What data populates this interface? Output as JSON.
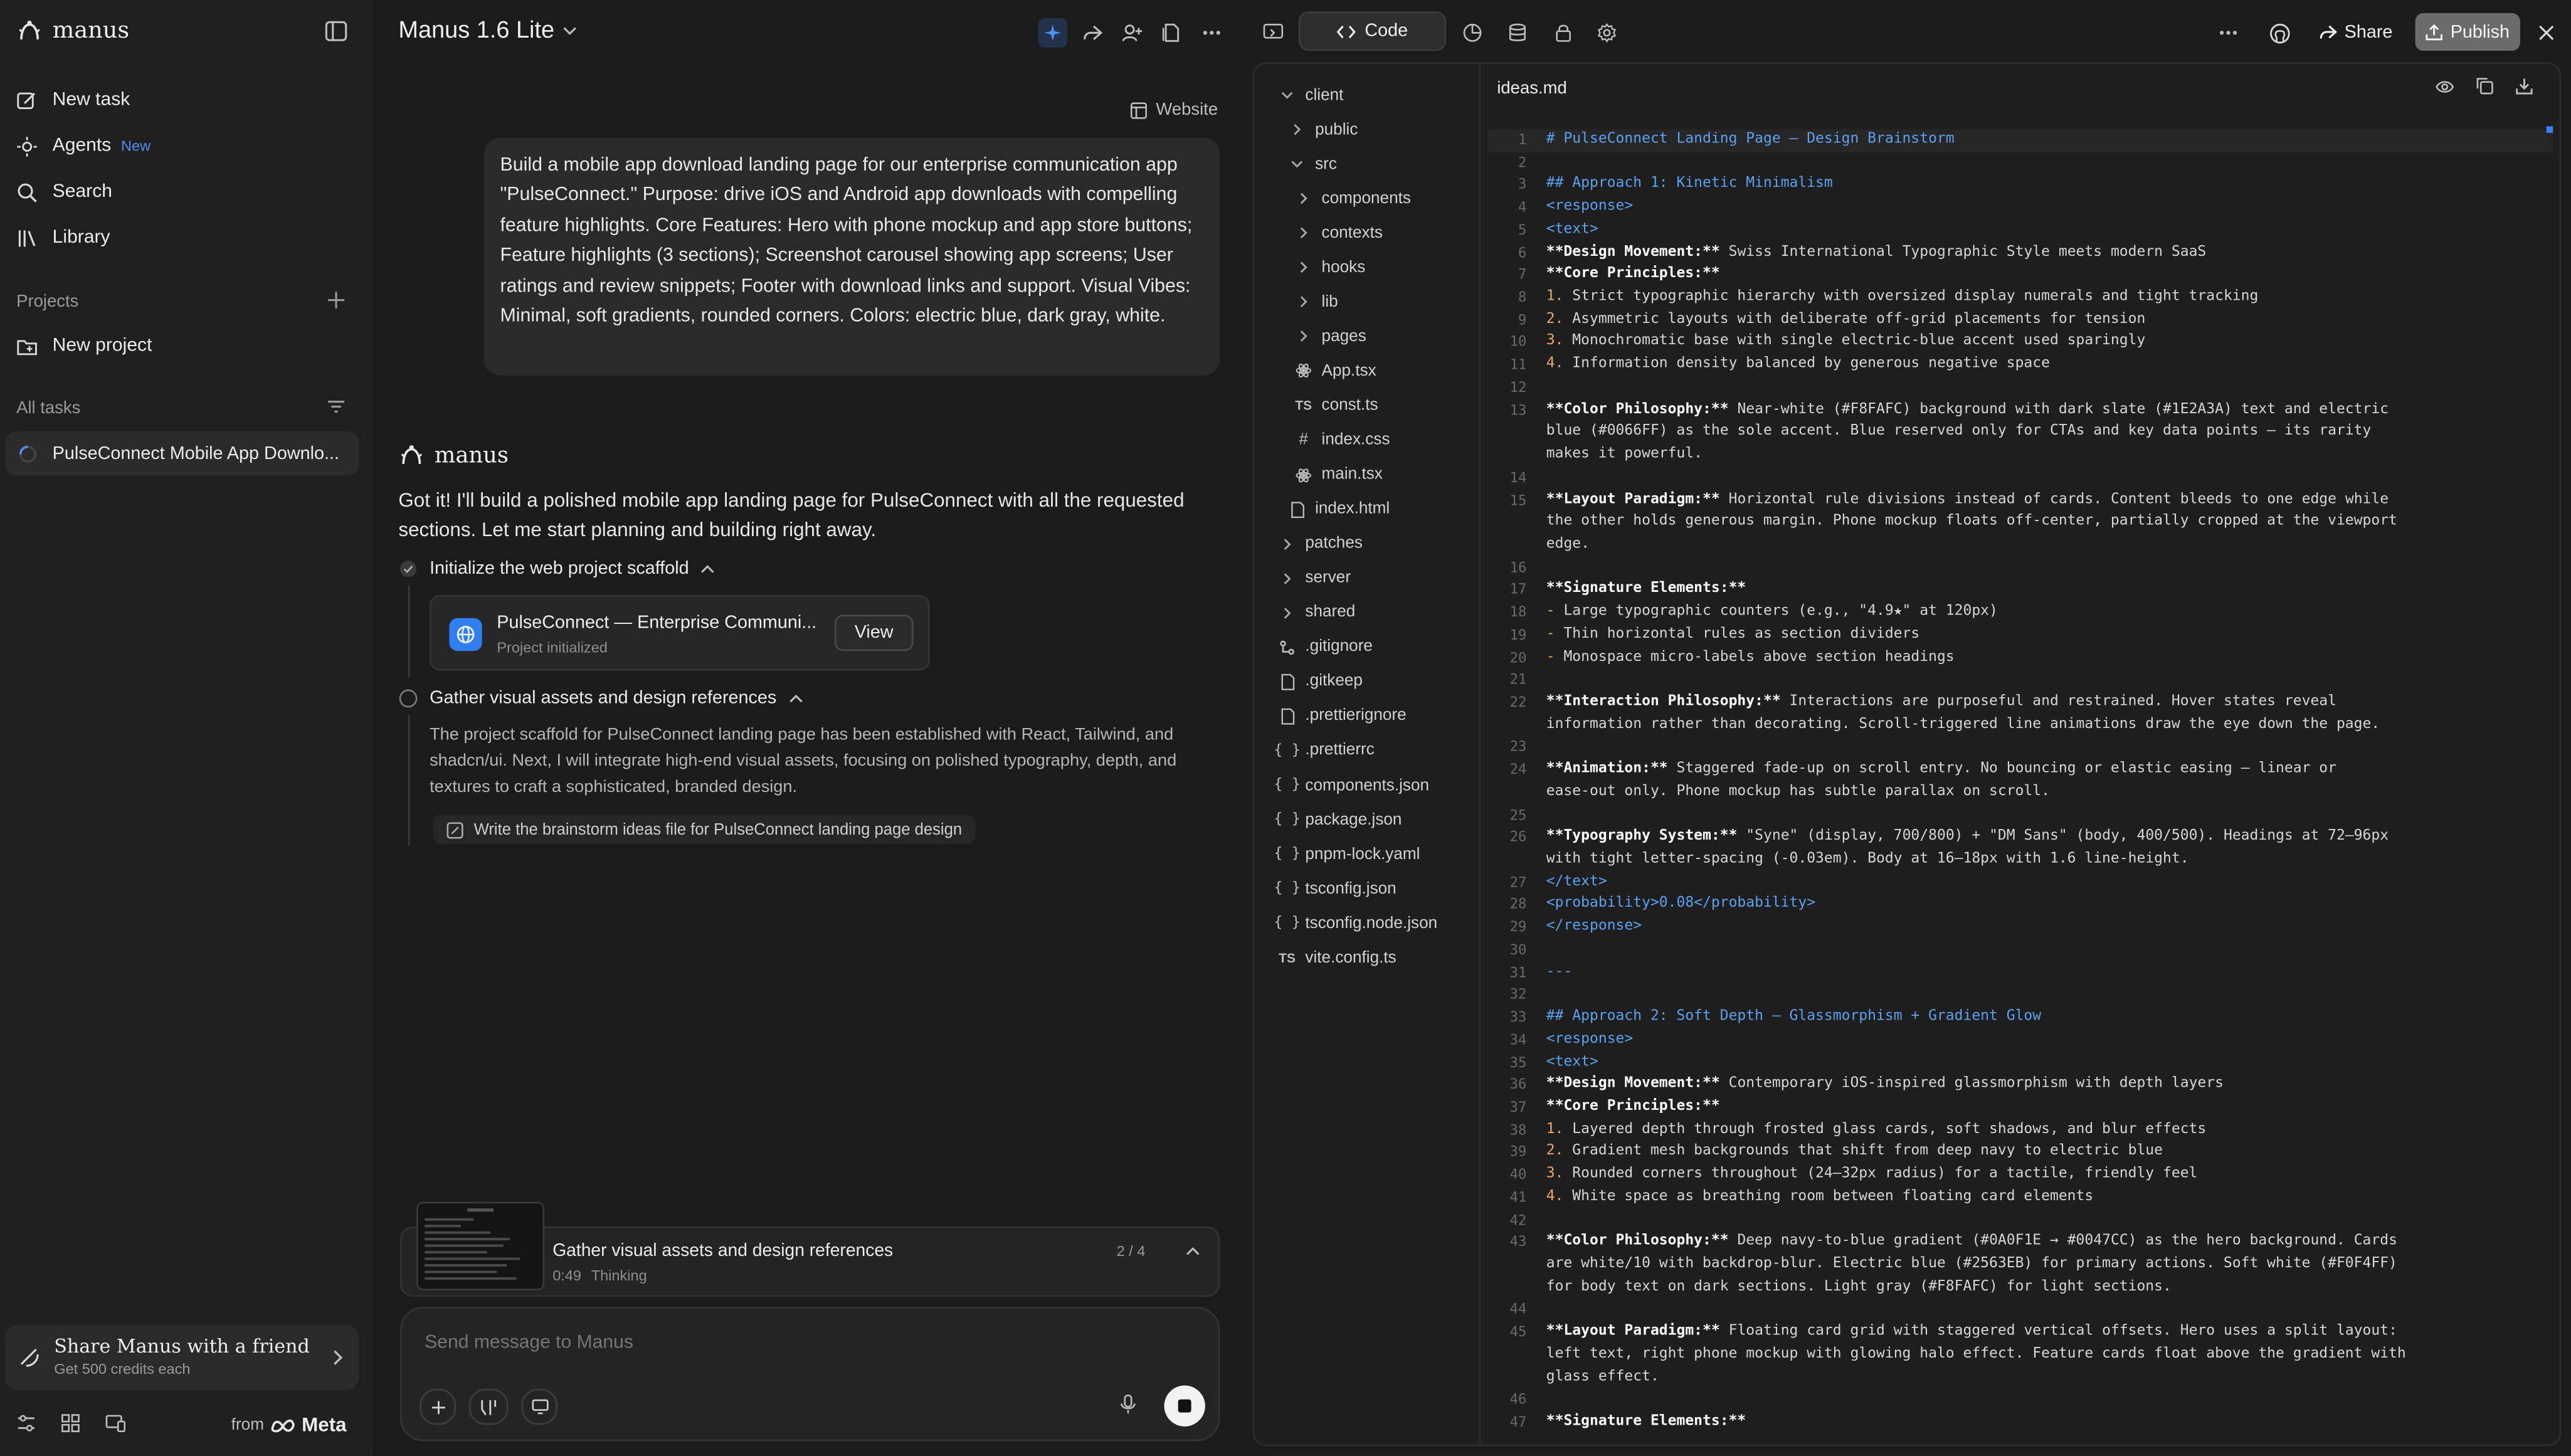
{
  "sidebar": {
    "brand": "manus",
    "nav": [
      {
        "label": "New task",
        "icon": "edit-icon"
      },
      {
        "label": "Agents",
        "icon": "agents-icon",
        "badge": "New"
      },
      {
        "label": "Search",
        "icon": "search-icon"
      },
      {
        "label": "Library",
        "icon": "library-icon"
      }
    ],
    "projects_label": "Projects",
    "new_project": "New project",
    "all_tasks_label": "All tasks",
    "task_item": "PulseConnect Mobile App Downlo...",
    "share_title": "Share Manus with a friend",
    "share_sub": "Get 500 credits each",
    "from_label": "from",
    "meta_label": "Meta"
  },
  "chat": {
    "model": "Manus 1.6 Lite",
    "website_label": "Website",
    "user_message": "Build a mobile app download landing page for our enterprise communication app \"PulseConnect.\" Purpose: drive iOS and Android app downloads with compelling feature highlights. Core Features: Hero with phone mockup and app store buttons; Feature highlights (3 sections); Screenshot carousel showing app screens; User ratings and review snippets; Footer with download links and support. Visual Vibes: Minimal, soft gradients, rounded corners. Colors: electric blue, dark gray, white.",
    "agent_name": "manus",
    "agent_reply": "Got it! I'll build a polished mobile app landing page for PulseConnect with all the requested sections. Let me start planning and building right away.",
    "step1": "Initialize the web project scaffold",
    "card_title": "PulseConnect — Enterprise Communi...",
    "card_sub": "Project initialized",
    "card_button": "View",
    "step2": "Gather visual assets and design references",
    "step2_desc": "The project scaffold for PulseConnect landing page has been established with React, Tailwind, and shadcn/ui. Next, I will integrate high-end visual assets, focusing on polished typography, depth, and textures to craft a sophisticated, branded design.",
    "subtask": "Write the brainstorm ideas file for PulseConnect landing page design",
    "status_title": "Gather visual assets and design references",
    "status_time": "0:49",
    "status_state": "Thinking",
    "status_count": "2 / 4",
    "input_placeholder": "Send message to Manus"
  },
  "topbar": {
    "code_tab": "Code",
    "share": "Share",
    "publish": "Publish"
  },
  "tree": [
    {
      "label": "client",
      "type": "folder-open",
      "depth": 0
    },
    {
      "label": "public",
      "type": "folder",
      "depth": 1
    },
    {
      "label": "src",
      "type": "folder-open",
      "depth": 1
    },
    {
      "label": "components",
      "type": "folder",
      "depth": 2
    },
    {
      "label": "contexts",
      "type": "folder",
      "depth": 2
    },
    {
      "label": "hooks",
      "type": "folder",
      "depth": 2
    },
    {
      "label": "lib",
      "type": "folder",
      "depth": 2
    },
    {
      "label": "pages",
      "type": "folder",
      "depth": 2
    },
    {
      "label": "App.tsx",
      "type": "react",
      "depth": 2
    },
    {
      "label": "const.ts",
      "type": "ts",
      "depth": 2
    },
    {
      "label": "index.css",
      "type": "css",
      "depth": 2
    },
    {
      "label": "main.tsx",
      "type": "react",
      "depth": 2
    },
    {
      "label": "index.html",
      "type": "file",
      "depth": 1
    },
    {
      "label": "patches",
      "type": "folder",
      "depth": 0
    },
    {
      "label": "server",
      "type": "folder",
      "depth": 0
    },
    {
      "label": "shared",
      "type": "folder",
      "depth": 0
    },
    {
      "label": ".gitignore",
      "type": "git",
      "depth": 0
    },
    {
      "label": ".gitkeep",
      "type": "file",
      "depth": 0
    },
    {
      "label": ".prettierignore",
      "type": "file",
      "depth": 0
    },
    {
      "label": ".prettierrc",
      "type": "json",
      "depth": 0
    },
    {
      "label": "components.json",
      "type": "json",
      "depth": 0
    },
    {
      "label": "package.json",
      "type": "json",
      "depth": 0
    },
    {
      "label": "pnpm-lock.yaml",
      "type": "json",
      "depth": 0
    },
    {
      "label": "tsconfig.json",
      "type": "json",
      "depth": 0
    },
    {
      "label": "tsconfig.node.json",
      "type": "json",
      "depth": 0
    },
    {
      "label": "vite.config.ts",
      "type": "ts",
      "depth": 0
    }
  ],
  "editor": {
    "filename": "ideas.md",
    "lines": [
      {
        "n": "1",
        "text": "# PulseConnect Landing Page — Design Brainstorm",
        "style": "h"
      },
      {
        "n": "2",
        "text": "",
        "style": ""
      },
      {
        "n": "3",
        "text": "## Approach 1: Kinetic Minimalism",
        "style": "h"
      },
      {
        "n": "4",
        "text": "<response>",
        "style": "tag"
      },
      {
        "n": "5",
        "text": "<text>",
        "style": "tag"
      },
      {
        "n": "6",
        "text": "**Design Movement:** Swiss International Typographic Style meets modern SaaS",
        "style": "b"
      },
      {
        "n": "7",
        "text": "**Core Principles:**",
        "style": "b"
      },
      {
        "n": "8",
        "text": "1. Strict typographic hierarchy with oversized display numerals and tight tracking",
        "style": "ol"
      },
      {
        "n": "9",
        "text": "2. Asymmetric layouts with deliberate off-grid placements for tension",
        "style": "ol"
      },
      {
        "n": "10",
        "text": "3. Monochromatic base with single electric-blue accent used sparingly",
        "style": "ol"
      },
      {
        "n": "11",
        "text": "4. Information density balanced by generous negative space",
        "style": "ol"
      },
      {
        "n": "12",
        "text": "",
        "style": ""
      },
      {
        "n": "13",
        "text": "**Color Philosophy:** Near-white (#F8FAFC) background with dark slate (#1E2A3A) text and electric",
        "style": "b"
      },
      {
        "n": "",
        "text": "blue (#0066FF) as the sole accent. Blue reserved only for CTAs and key data points — its rarity",
        "style": ""
      },
      {
        "n": "",
        "text": "makes it powerful.",
        "style": ""
      },
      {
        "n": "14",
        "text": "",
        "style": ""
      },
      {
        "n": "15",
        "text": "**Layout Paradigm:** Horizontal rule divisions instead of cards. Content bleeds to one edge while",
        "style": "b"
      },
      {
        "n": "",
        "text": "the other holds generous margin. Phone mockup floats off-center, partially cropped at the viewport",
        "style": ""
      },
      {
        "n": "",
        "text": "edge.",
        "style": ""
      },
      {
        "n": "16",
        "text": "",
        "style": ""
      },
      {
        "n": "17",
        "text": "**Signature Elements:**",
        "style": "b"
      },
      {
        "n": "18",
        "text": "- Large typographic counters (e.g., \"4.9★\" at 120px)",
        "style": "ol"
      },
      {
        "n": "19",
        "text": "- Thin horizontal rules as section dividers",
        "style": "ol"
      },
      {
        "n": "20",
        "text": "- Monospace micro-labels above section headings",
        "style": "ol"
      },
      {
        "n": "21",
        "text": "",
        "style": ""
      },
      {
        "n": "22",
        "text": "**Interaction Philosophy:** Interactions are purposeful and restrained. Hover states reveal",
        "style": "b"
      },
      {
        "n": "",
        "text": "information rather than decorating. Scroll-triggered line animations draw the eye down the page.",
        "style": ""
      },
      {
        "n": "23",
        "text": "",
        "style": ""
      },
      {
        "n": "24",
        "text": "**Animation:** Staggered fade-up on scroll entry. No bouncing or elastic easing — linear or",
        "style": "b"
      },
      {
        "n": "",
        "text": "ease-out only. Phone mockup has subtle parallax on scroll.",
        "style": ""
      },
      {
        "n": "25",
        "text": "",
        "style": ""
      },
      {
        "n": "26",
        "text": "**Typography System:** \"Syne\" (display, 700/800) + \"DM Sans\" (body, 400/500). Headings at 72–96px",
        "style": "b"
      },
      {
        "n": "",
        "text": "with tight letter-spacing (-0.03em). Body at 16–18px with 1.6 line-height.",
        "style": ""
      },
      {
        "n": "27",
        "text": "</text>",
        "style": "tag"
      },
      {
        "n": "28",
        "text": "<probability>0.08</probability>",
        "style": "tag"
      },
      {
        "n": "29",
        "text": "</response>",
        "style": "tag"
      },
      {
        "n": "30",
        "text": "",
        "style": ""
      },
      {
        "n": "31",
        "text": "---",
        "style": "h"
      },
      {
        "n": "32",
        "text": "",
        "style": ""
      },
      {
        "n": "33",
        "text": "## Approach 2: Soft Depth — Glassmorphism + Gradient Glow",
        "style": "h"
      },
      {
        "n": "34",
        "text": "<response>",
        "style": "tag"
      },
      {
        "n": "35",
        "text": "<text>",
        "style": "tag"
      },
      {
        "n": "36",
        "text": "**Design Movement:** Contemporary iOS-inspired glassmorphism with depth layers",
        "style": "b"
      },
      {
        "n": "37",
        "text": "**Core Principles:**",
        "style": "b"
      },
      {
        "n": "38",
        "text": "1. Layered depth through frosted glass cards, soft shadows, and blur effects",
        "style": "ol"
      },
      {
        "n": "39",
        "text": "2. Gradient mesh backgrounds that shift from deep navy to electric blue",
        "style": "ol"
      },
      {
        "n": "40",
        "text": "3. Rounded corners throughout (24–32px radius) for a tactile, friendly feel",
        "style": "ol"
      },
      {
        "n": "41",
        "text": "4. White space as breathing room between floating card elements",
        "style": "ol"
      },
      {
        "n": "42",
        "text": "",
        "style": ""
      },
      {
        "n": "43",
        "text": "**Color Philosophy:** Deep navy-to-blue gradient (#0A0F1E → #0047CC) as the hero background. Cards",
        "style": "b"
      },
      {
        "n": "",
        "text": "are white/10 with backdrop-blur. Electric blue (#2563EB) for primary actions. Soft white (#F0F4FF)",
        "style": ""
      },
      {
        "n": "",
        "text": "for body text on dark sections. Light gray (#F8FAFC) for light sections.",
        "style": ""
      },
      {
        "n": "44",
        "text": "",
        "style": ""
      },
      {
        "n": "45",
        "text": "**Layout Paradigm:** Floating card grid with staggered vertical offsets. Hero uses a split layout:",
        "style": "b"
      },
      {
        "n": "",
        "text": "left text, right phone mockup with glowing halo effect. Feature cards float above the gradient with",
        "style": ""
      },
      {
        "n": "",
        "text": "glass effect.",
        "style": ""
      },
      {
        "n": "46",
        "text": "",
        "style": ""
      },
      {
        "n": "47",
        "text": "**Signature Elements:**",
        "style": "b"
      }
    ]
  },
  "colors": {
    "accent": "#3b82f6",
    "badge": "#4f8ff7"
  }
}
